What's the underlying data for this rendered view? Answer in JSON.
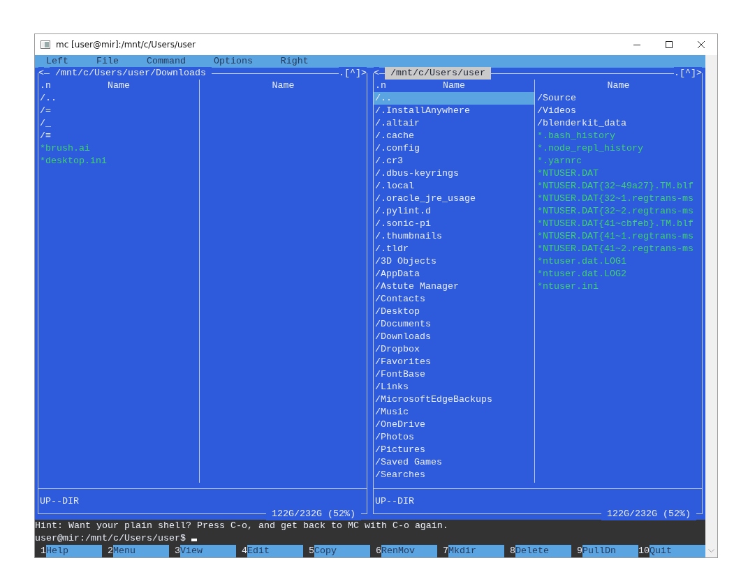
{
  "window": {
    "title": "mc [user@mir]:/mnt/c/Users/user"
  },
  "menu": [
    "Left",
    "File",
    "Command",
    "Options",
    "Right"
  ],
  "panels": [
    {
      "active": false,
      "nav_left": "<",
      "path": "/mnt/c/Users/user/Downloads",
      "nav_right": ".[^]>",
      "columns": [
        {
          "sort": ".n",
          "header": "Name",
          "files": [
            {
              "name": "/..",
              "kind": "dir",
              "selected": false
            },
            {
              "name": "/=",
              "kind": "dir",
              "selected": false
            },
            {
              "name": "/_",
              "kind": "dir",
              "selected": false
            },
            {
              "name": "/≡",
              "kind": "dir",
              "selected": false
            },
            {
              "name": "*brush.ai",
              "kind": "exec",
              "selected": false
            },
            {
              "name": "*desktop.ini",
              "kind": "exec",
              "selected": false
            }
          ]
        },
        {
          "header": "Name"
        }
      ],
      "status": "UP--DIR",
      "free_space": "122G/232G (52%)"
    },
    {
      "active": true,
      "nav_left": "<",
      "path": "/mnt/c/Users/user",
      "nav_right": ".[^]>",
      "columns": [
        {
          "sort": ".n",
          "header": "Name",
          "files": [
            {
              "name": "/..",
              "kind": "dir",
              "selected": true
            },
            {
              "name": "/.InstallAnywhere",
              "kind": "dir",
              "selected": false
            },
            {
              "name": "/.altair",
              "kind": "dir",
              "selected": false
            },
            {
              "name": "/.cache",
              "kind": "dir",
              "selected": false
            },
            {
              "name": "/.config",
              "kind": "dir",
              "selected": false
            },
            {
              "name": "/.cr3",
              "kind": "dir",
              "selected": false
            },
            {
              "name": "/.dbus-keyrings",
              "kind": "dir",
              "selected": false
            },
            {
              "name": "/.local",
              "kind": "dir",
              "selected": false
            },
            {
              "name": "/.oracle_jre_usage",
              "kind": "dir",
              "selected": false
            },
            {
              "name": "/.pylint.d",
              "kind": "dir",
              "selected": false
            },
            {
              "name": "/.sonic-pi",
              "kind": "dir",
              "selected": false
            },
            {
              "name": "/.thumbnails",
              "kind": "dir",
              "selected": false
            },
            {
              "name": "/.tldr",
              "kind": "dir",
              "selected": false
            },
            {
              "name": "/3D Objects",
              "kind": "dir",
              "selected": false
            },
            {
              "name": "/AppData",
              "kind": "dir",
              "selected": false
            },
            {
              "name": "/Astute Manager",
              "kind": "dir",
              "selected": false
            },
            {
              "name": "/Contacts",
              "kind": "dir",
              "selected": false
            },
            {
              "name": "/Desktop",
              "kind": "dir",
              "selected": false
            },
            {
              "name": "/Documents",
              "kind": "dir",
              "selected": false
            },
            {
              "name": "/Downloads",
              "kind": "dir",
              "selected": false
            },
            {
              "name": "/Dropbox",
              "kind": "dir",
              "selected": false
            },
            {
              "name": "/Favorites",
              "kind": "dir",
              "selected": false
            },
            {
              "name": "/FontBase",
              "kind": "dir",
              "selected": false
            },
            {
              "name": "/Links",
              "kind": "dir",
              "selected": false
            },
            {
              "name": "/MicrosoftEdgeBackups",
              "kind": "dir",
              "selected": false
            },
            {
              "name": "/Music",
              "kind": "dir",
              "selected": false
            },
            {
              "name": "/OneDrive",
              "kind": "dir",
              "selected": false
            },
            {
              "name": "/Photos",
              "kind": "dir",
              "selected": false
            },
            {
              "name": "/Pictures",
              "kind": "dir",
              "selected": false
            },
            {
              "name": "/Saved Games",
              "kind": "dir",
              "selected": false
            },
            {
              "name": "/Searches",
              "kind": "dir",
              "selected": false
            }
          ]
        },
        {
          "header": "Name",
          "files": [
            {
              "name": "/Source",
              "kind": "dir",
              "selected": false
            },
            {
              "name": "/Videos",
              "kind": "dir",
              "selected": false
            },
            {
              "name": "/blenderkit_data",
              "kind": "dir",
              "selected": false
            },
            {
              "name": "*.bash_history",
              "kind": "exec",
              "selected": false
            },
            {
              "name": "*.node_repl_history",
              "kind": "exec",
              "selected": false
            },
            {
              "name": "*.yarnrc",
              "kind": "exec",
              "selected": false
            },
            {
              "name": "*NTUSER.DAT",
              "kind": "exec",
              "selected": false
            },
            {
              "name": "*NTUSER.DAT{32~49a27}.TM.blf",
              "kind": "exec",
              "selected": false
            },
            {
              "name": "*NTUSER.DAT{32~1.regtrans-ms",
              "kind": "exec",
              "selected": false
            },
            {
              "name": "*NTUSER.DAT{32~2.regtrans-ms",
              "kind": "exec",
              "selected": false
            },
            {
              "name": "*NTUSER.DAT{41~cbfeb}.TM.blf",
              "kind": "exec",
              "selected": false
            },
            {
              "name": "*NTUSER.DAT{41~1.regtrans-ms",
              "kind": "exec",
              "selected": false
            },
            {
              "name": "*NTUSER.DAT{41~2.regtrans-ms",
              "kind": "exec",
              "selected": false
            },
            {
              "name": "*ntuser.dat.LOG1",
              "kind": "exec",
              "selected": false
            },
            {
              "name": "*ntuser.dat.LOG2",
              "kind": "exec",
              "selected": false
            },
            {
              "name": "*ntuser.ini",
              "kind": "exec",
              "selected": false
            }
          ]
        }
      ],
      "status": "UP--DIR",
      "free_space": "122G/232G (52%)"
    }
  ],
  "hint": "Hint: Want your plain shell? Press C-o, and get back to MC with C-o again.",
  "prompt": "user@mir:/mnt/c/Users/user$",
  "function_keys": [
    {
      "number": "1",
      "label": "Help"
    },
    {
      "number": "2",
      "label": "Menu"
    },
    {
      "number": "3",
      "label": "View"
    },
    {
      "number": "4",
      "label": "Edit"
    },
    {
      "number": "5",
      "label": "Copy"
    },
    {
      "number": "6",
      "label": "RenMov"
    },
    {
      "number": "7",
      "label": "Mkdir"
    },
    {
      "number": "8",
      "label": "Delete"
    },
    {
      "number": "9",
      "label": "PullDn"
    },
    {
      "number": "10",
      "label": "Quit"
    }
  ]
}
